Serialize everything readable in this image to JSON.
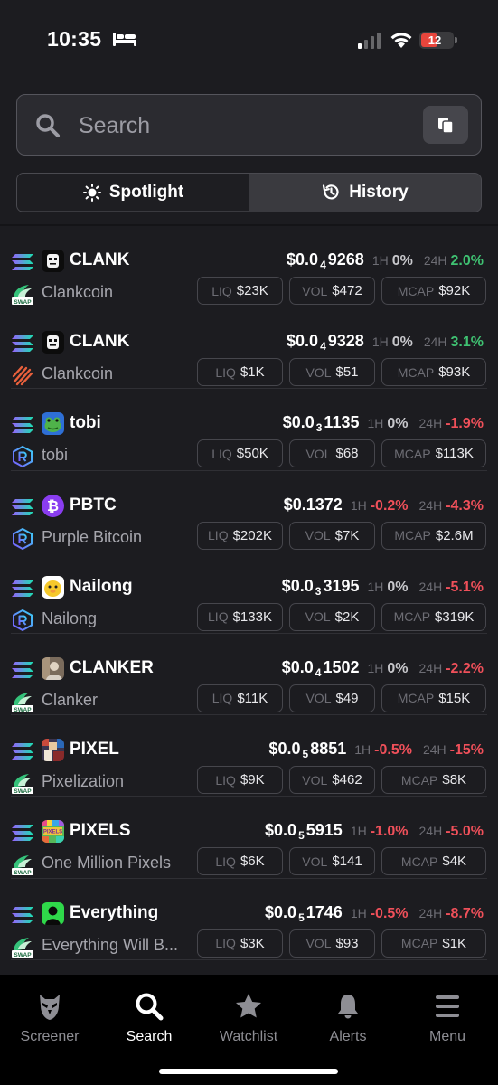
{
  "status_bar": {
    "time": "10:35",
    "battery": "12"
  },
  "search": {
    "placeholder": "Search"
  },
  "toggle": {
    "spotlight_label": "Spotlight",
    "history_label": "History"
  },
  "colors": {
    "positive": "#3fc272",
    "negative": "#f0505a",
    "background": "#1c1c20"
  },
  "rows": [
    {
      "symbol": "CLANK",
      "name": "Clankcoin",
      "logo": "robot-icon",
      "dex": "swap-icon",
      "price_main": "$0.0",
      "price_zeros": "4",
      "price_tail": "9268",
      "h1_label": "1H",
      "h1": "0%",
      "h24_label": "24H",
      "h24": "2.0%",
      "liq_label": "LIQ",
      "liq": "$23K",
      "vol_label": "VOL",
      "vol": "$472",
      "mcap_label": "MCAP",
      "mcap": "$92K"
    },
    {
      "symbol": "CLANK",
      "name": "Clankcoin",
      "logo": "robot-icon",
      "dex": "stripes-icon",
      "price_main": "$0.0",
      "price_zeros": "4",
      "price_tail": "9328",
      "h1_label": "1H",
      "h1": "0%",
      "h24_label": "24H",
      "h24": "3.1%",
      "liq_label": "LIQ",
      "liq": "$1K",
      "vol_label": "VOL",
      "vol": "$51",
      "mcap_label": "MCAP",
      "mcap": "$93K"
    },
    {
      "symbol": "tobi",
      "name": "tobi",
      "logo": "frog-icon",
      "dex": "raydium-icon",
      "price_main": "$0.0",
      "price_zeros": "3",
      "price_tail": "1135",
      "h1_label": "1H",
      "h1": "0%",
      "h24_label": "24H",
      "h24": "-1.9%",
      "liq_label": "LIQ",
      "liq": "$50K",
      "vol_label": "VOL",
      "vol": "$68",
      "mcap_label": "MCAP",
      "mcap": "$113K"
    },
    {
      "symbol": "PBTC",
      "name": "Purple Bitcoin",
      "logo": "bitcoin-icon",
      "dex": "raydium-icon",
      "price_main": "$0.1372",
      "price_zeros": "",
      "price_tail": "",
      "h1_label": "1H",
      "h1": "-0.2%",
      "h24_label": "24H",
      "h24": "-4.3%",
      "liq_label": "LIQ",
      "liq": "$202K",
      "vol_label": "VOL",
      "vol": "$7K",
      "mcap_label": "MCAP",
      "mcap": "$2.6M"
    },
    {
      "symbol": "Nailong",
      "name": "Nailong",
      "logo": "nailong-icon",
      "dex": "raydium-icon",
      "price_main": "$0.0",
      "price_zeros": "3",
      "price_tail": "3195",
      "h1_label": "1H",
      "h1": "0%",
      "h24_label": "24H",
      "h24": "-5.1%",
      "liq_label": "LIQ",
      "liq": "$133K",
      "vol_label": "VOL",
      "vol": "$2K",
      "mcap_label": "MCAP",
      "mcap": "$319K"
    },
    {
      "symbol": "CLANKER",
      "name": "Clanker",
      "logo": "portrait-icon",
      "dex": "swap-icon",
      "price_main": "$0.0",
      "price_zeros": "4",
      "price_tail": "1502",
      "h1_label": "1H",
      "h1": "0%",
      "h24_label": "24H",
      "h24": "-2.2%",
      "liq_label": "LIQ",
      "liq": "$11K",
      "vol_label": "VOL",
      "vol": "$49",
      "mcap_label": "MCAP",
      "mcap": "$15K"
    },
    {
      "symbol": "PIXEL",
      "name": "Pixelization",
      "logo": "pixel-art-icon",
      "dex": "swap-icon",
      "price_main": "$0.0",
      "price_zeros": "5",
      "price_tail": "8851",
      "h1_label": "1H",
      "h1": "-0.5%",
      "h24_label": "24H",
      "h24": "-15%",
      "liq_label": "LIQ",
      "liq": "$9K",
      "vol_label": "VOL",
      "vol": "$462",
      "mcap_label": "MCAP",
      "mcap": "$8K"
    },
    {
      "symbol": "PIXELS",
      "name": "One Million Pixels",
      "logo": "pixels-icon",
      "dex": "swap-icon",
      "price_main": "$0.0",
      "price_zeros": "5",
      "price_tail": "5915",
      "h1_label": "1H",
      "h1": "-1.0%",
      "h24_label": "24H",
      "h24": "-5.0%",
      "liq_label": "LIQ",
      "liq": "$6K",
      "vol_label": "VOL",
      "vol": "$141",
      "mcap_label": "MCAP",
      "mcap": "$4K"
    },
    {
      "symbol": "Everything",
      "name": "Everything Will B...",
      "logo": "silhouette-icon",
      "dex": "swap-icon",
      "price_main": "$0.0",
      "price_zeros": "5",
      "price_tail": "1746",
      "h1_label": "1H",
      "h1": "-0.5%",
      "h24_label": "24H",
      "h24": "-8.7%",
      "liq_label": "LIQ",
      "liq": "$3K",
      "vol_label": "VOL",
      "vol": "$93",
      "mcap_label": "MCAP",
      "mcap": "$1K"
    }
  ],
  "tabbar": {
    "screener": "Screener",
    "search": "Search",
    "watchlist": "Watchlist",
    "alerts": "Alerts",
    "menu": "Menu"
  }
}
